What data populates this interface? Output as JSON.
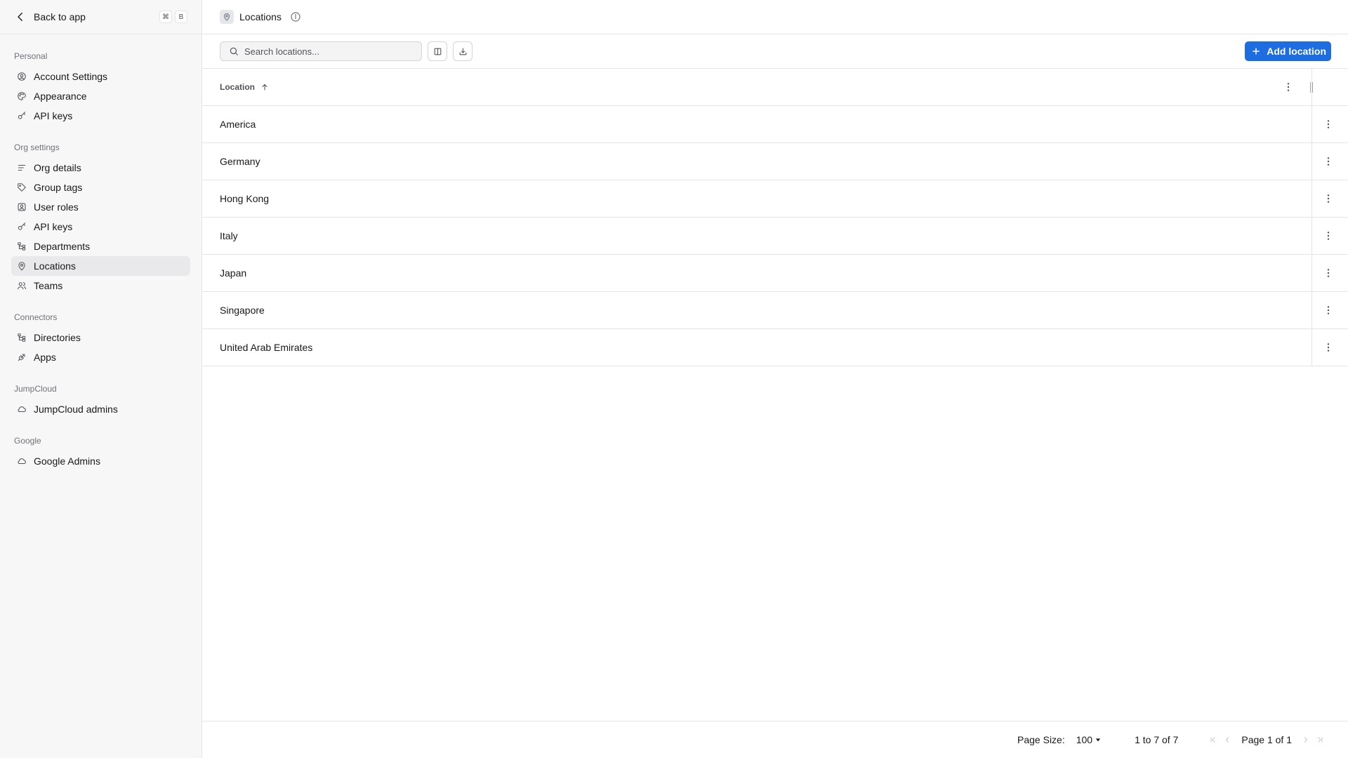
{
  "sidebar": {
    "back_label": "Back to app",
    "shortcut": [
      "⌘",
      "B"
    ],
    "sections": [
      {
        "heading": "Personal",
        "items": [
          {
            "label": "Account Settings",
            "icon": "user-circle-icon"
          },
          {
            "label": "Appearance",
            "icon": "palette-icon"
          },
          {
            "label": "API keys",
            "icon": "key-icon"
          }
        ]
      },
      {
        "heading": "Org settings",
        "items": [
          {
            "label": "Org details",
            "icon": "text-lines-icon"
          },
          {
            "label": "Group tags",
            "icon": "tag-icon"
          },
          {
            "label": "User roles",
            "icon": "user-square-icon"
          },
          {
            "label": "API keys",
            "icon": "key-icon"
          },
          {
            "label": "Departments",
            "icon": "hierarchy-icon"
          },
          {
            "label": "Locations",
            "icon": "map-pin-icon",
            "active": true
          },
          {
            "label": "Teams",
            "icon": "users-icon"
          }
        ]
      },
      {
        "heading": "Connectors",
        "items": [
          {
            "label": "Directories",
            "icon": "hierarchy-icon"
          },
          {
            "label": "Apps",
            "icon": "plug-icon"
          }
        ]
      },
      {
        "heading": "JumpCloud",
        "items": [
          {
            "label": "JumpCloud admins",
            "icon": "cloud-icon"
          }
        ]
      },
      {
        "heading": "Google",
        "items": [
          {
            "label": "Google Admins",
            "icon": "cloud-icon"
          }
        ]
      }
    ]
  },
  "header": {
    "title": "Locations"
  },
  "toolbar": {
    "search_placeholder": "Search locations...",
    "add_label": "Add location"
  },
  "table": {
    "column_header": "Location",
    "sort": "ascending",
    "rows": [
      "America",
      "Germany",
      "Hong Kong",
      "Italy",
      "Japan",
      "Singapore",
      "United Arab Emirates"
    ]
  },
  "pagination": {
    "page_size_label": "Page Size:",
    "page_size": "100",
    "range_text": "1 to 7 of 7",
    "page_text": "Page 1 of 1"
  },
  "colors": {
    "accent": "#1d6ce0",
    "sidebar_bg": "#f7f7f7",
    "active_item_bg": "#e9e9eb",
    "border": "#e4e4e7"
  }
}
